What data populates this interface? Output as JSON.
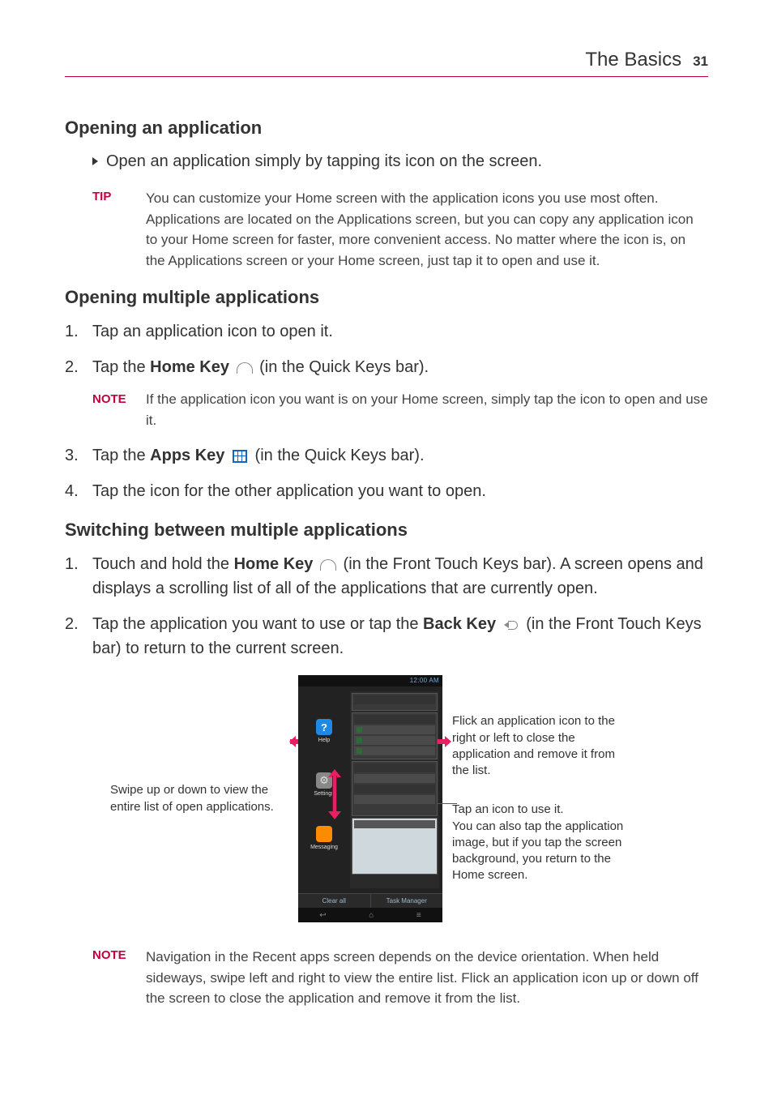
{
  "header": {
    "title": "The Basics",
    "page": "31"
  },
  "sec1": {
    "heading": "Opening an application",
    "bullet": "Open an application simply by tapping its icon on the screen.",
    "tip_label": "TIP",
    "tip_body": "You can customize your Home screen with the application icons you use most often. Applications are located on the Applications screen, but you can copy any application icon to your Home screen for faster, more convenient access. No matter where the icon is, on the Applications screen or your Home screen, just tap it to open and use it."
  },
  "sec2": {
    "heading": "Opening multiple applications",
    "step1": "Tap an application icon to open it.",
    "step2a": "Tap the ",
    "step2_key": "Home Key",
    "step2b": " (in the Quick Keys bar).",
    "note_label": "NOTE",
    "note_body": "If the application icon you want is on your Home screen, simply tap the icon to open and use it.",
    "step3a": "Tap the ",
    "step3_key": "Apps Key",
    "step3b": " (in the Quick Keys bar).",
    "step4": "Tap the icon for the other application you want to open."
  },
  "sec3": {
    "heading": "Switching between multiple applications",
    "step1a": "Touch and hold the ",
    "step1_key": "Home Key",
    "step1b": " (in the Front Touch Keys bar). A screen opens and displays a scrolling list of all of the applications that are currently open.",
    "step2a": "Tap the application you want to use or tap the ",
    "step2_key": "Back Key",
    "step2b": " (in the Front Touch Keys bar) to return to the current screen."
  },
  "figure": {
    "left_callout": "Swipe up or down to view the entire list of open applications.",
    "right_callout1": "Flick an application icon to the right or left to close the application and remove it from the list.",
    "right_callout2a": "Tap an icon to use it.",
    "right_callout2b": "You can also tap the application image, but if you tap the screen background, you return to the Home screen.",
    "phone": {
      "status": "12:00 AM",
      "app1": "Help",
      "app2": "Settings",
      "app3": "Messaging",
      "btn_clear": "Clear all",
      "btn_task": "Task Manager"
    }
  },
  "bottom_note": {
    "label": "NOTE",
    "body": "Navigation in the Recent apps screen depends on the device orientation. When held sideways, swipe left and right to view the entire list. Flick an application icon up or down off the screen to close the application and remove it from the list."
  }
}
